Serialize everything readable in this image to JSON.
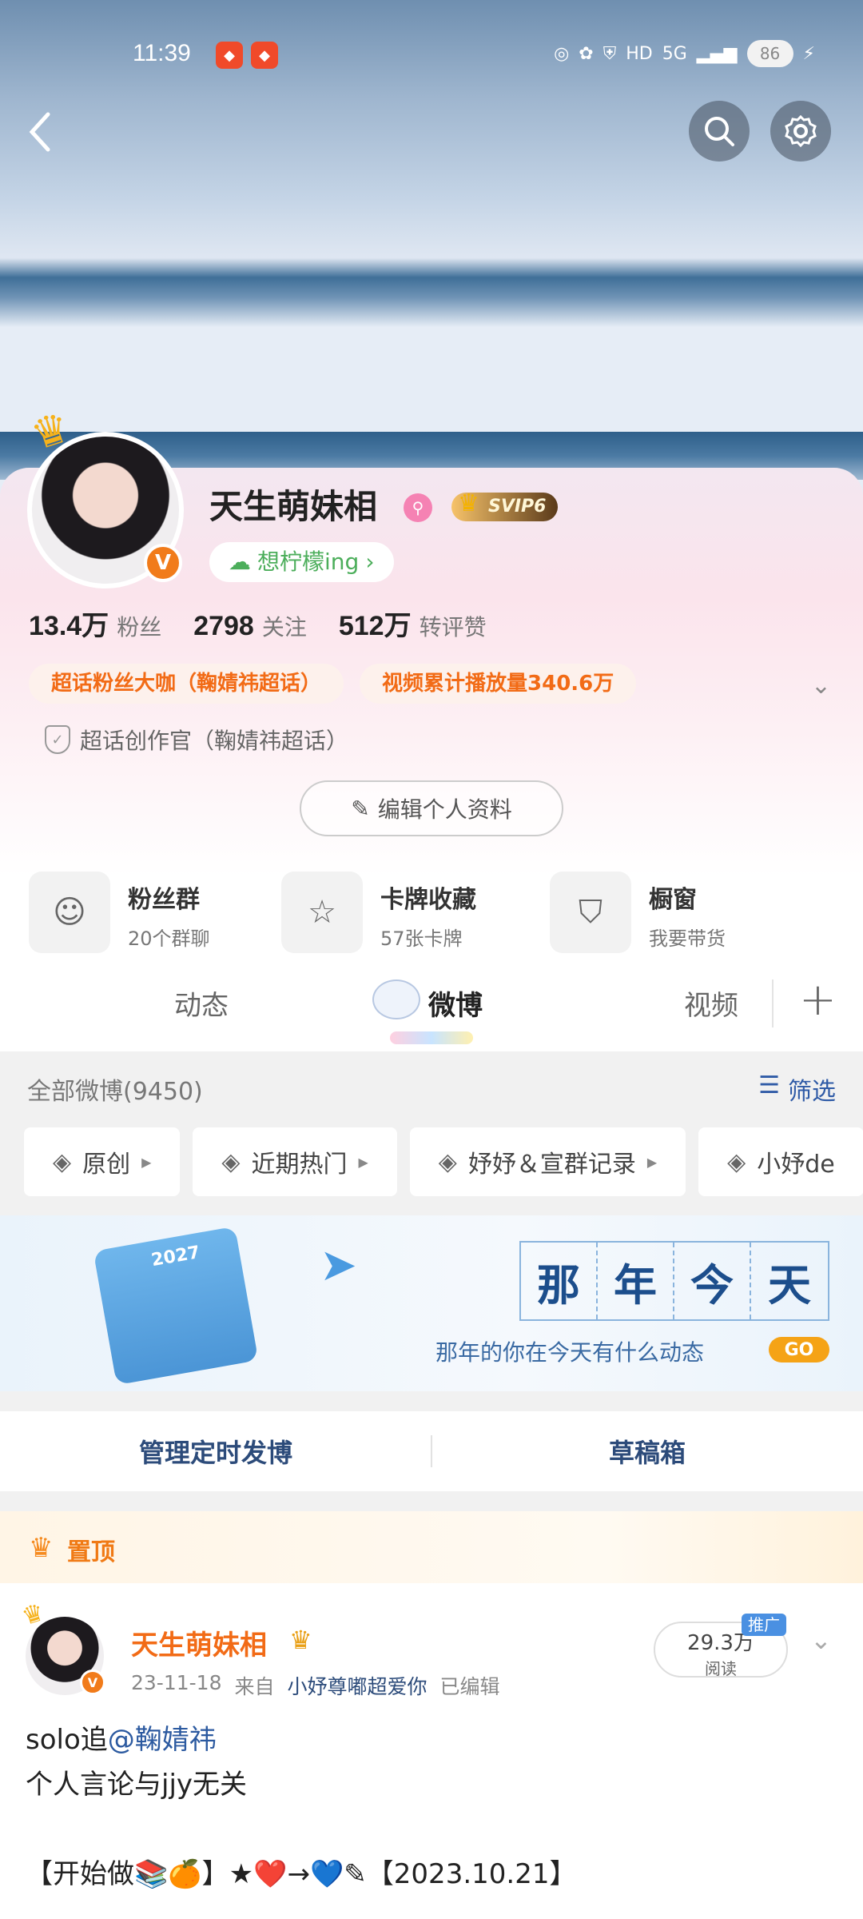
{
  "status_bar": {
    "time": "11:39",
    "battery": "86",
    "network": "5G"
  },
  "profile": {
    "name": "天生萌妹相",
    "vip": "SVIP6",
    "status": "想柠檬ing",
    "stats": [
      {
        "num": "13.4万",
        "label": "粉丝"
      },
      {
        "num": "2798",
        "label": "关注"
      },
      {
        "num": "512万",
        "label": "转评赞"
      }
    ],
    "tags": [
      "超话粉丝大咖（鞠婧祎超话）",
      "视频累计播放量340.6万"
    ],
    "verify": "超话创作官（鞠婧祎超话）",
    "edit_label": "编辑个人资料"
  },
  "tools": [
    {
      "title": "粉丝群",
      "sub": "20个群聊",
      "icon": "fans-group-icon"
    },
    {
      "title": "卡牌收藏",
      "sub": "57张卡牌",
      "icon": "card-icon"
    },
    {
      "title": "橱窗",
      "sub": "我要带货",
      "icon": "shop-bag-icon"
    }
  ],
  "tabs": [
    "动态",
    "微博",
    "视频"
  ],
  "feed": {
    "all_label": "全部微博(9450)",
    "filter_label": "筛选",
    "chips": [
      "原创",
      "近期热门",
      "妤妤＆宣群记录",
      "小妤de"
    ]
  },
  "banner": {
    "year": "2027",
    "title_chars": [
      "那",
      "年",
      "今",
      "天"
    ],
    "subtitle": "那年的你在今天有什么动态",
    "go": "GO"
  },
  "manage": {
    "scheduled": "管理定时发博",
    "drafts": "草稿箱"
  },
  "pinned_label": "置顶",
  "post": {
    "author": "天生萌妹相",
    "date": "23-11-18",
    "from_label": "来自",
    "source": "小妤尊嘟超爱你",
    "edited": "已编辑",
    "reads": "29.3万",
    "reads_label": "阅读",
    "promo": "推广",
    "line1_prefix": "solo追",
    "mention": "@鞠婧祎",
    "line2": "个人言论与jjy无关",
    "line3": "【开始做📚🍊】★❤️→💙✎【2023.10.21】"
  }
}
